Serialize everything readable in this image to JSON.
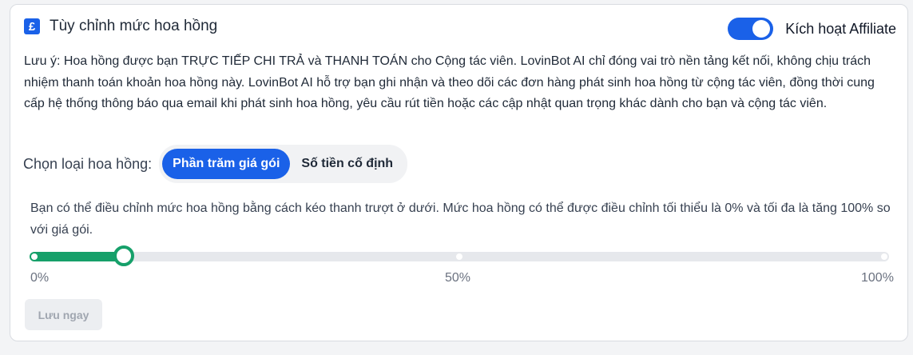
{
  "header": {
    "icon": "pound-icon",
    "icon_glyph": "£",
    "title": "Tùy chỉnh mức hoa hồng",
    "toggle_label": "Kích hoạt Affiliate",
    "toggle_on": true
  },
  "note": "Lưu ý: Hoa hồng được bạn TRỰC TIẾP CHI TRẢ và THANH TOÁN cho Cộng tác viên. LovinBot AI chỉ đóng vai trò nền tảng kết nối, không chịu trách nhiệm thanh toán khoản hoa hồng này. LovinBot AI hỗ trợ bạn ghi nhận và theo dõi các đơn hàng phát sinh hoa hồng từ cộng tác viên, đồng thời cung cấp hệ thống thông báo qua email khi phát sinh hoa hồng, yêu cầu rút tiền hoặc các cập nhật quan trọng khác dành cho bạn và cộng tác viên.",
  "commission_type": {
    "label": "Chọn loại hoa hồng:",
    "options": [
      "Phần trăm giá gói",
      "Số tiền cố định"
    ],
    "selected": "Phần trăm giá gói"
  },
  "slider": {
    "description": "Bạn có thể điều chỉnh mức hoa hồng bằng cách kéo thanh trượt ở dưới. Mức hoa hồng có thể được điều chỉnh tối thiểu là 0% và tối đa là tăng 100% so với giá gói.",
    "value_percent": 11,
    "min_label": "0%",
    "mid_label": "50%",
    "max_label": "100%"
  },
  "save_label": "Lưu ngay",
  "colors": {
    "primary": "#1a61e8",
    "slider_fill": "#16a06a"
  }
}
